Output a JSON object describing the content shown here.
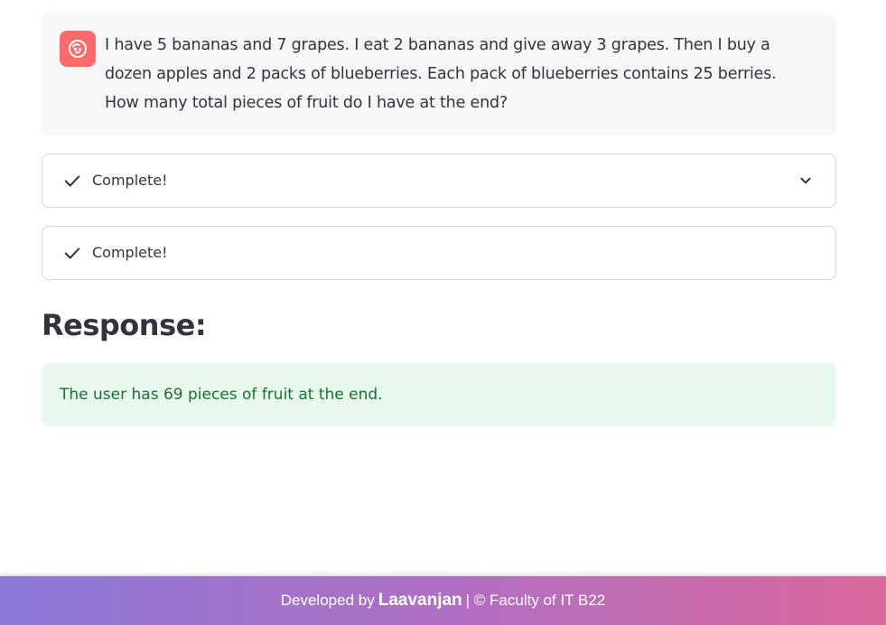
{
  "chat": {
    "avatar_icon": "user-face-icon",
    "avatar_color": "#ff6b6b",
    "message": "I have 5 bananas and 7 grapes. I eat 2 bananas and give away 3 grapes. Then I buy a dozen apples and 2 packs of blueberries. Each pack of blueberries contains 25 berries. How many total pieces of fruit do I have at the end?"
  },
  "status_boxes": [
    {
      "icon": "check-icon",
      "label": "Complete!",
      "expandable": true,
      "expand_icon": "chevron-down-icon"
    },
    {
      "icon": "check-icon",
      "label": "Complete!",
      "expandable": false
    }
  ],
  "response": {
    "heading": "Response:",
    "text": "The user has 69 pieces of fruit at the end.",
    "color": "#177233",
    "background": "#e8f8ec"
  },
  "footer": {
    "prefix": "Developed by",
    "author": "Laavanjan",
    "suffix": "| © Faculty of IT B22",
    "gradient_start": "#8b78d8",
    "gradient_end": "#d9679a"
  }
}
